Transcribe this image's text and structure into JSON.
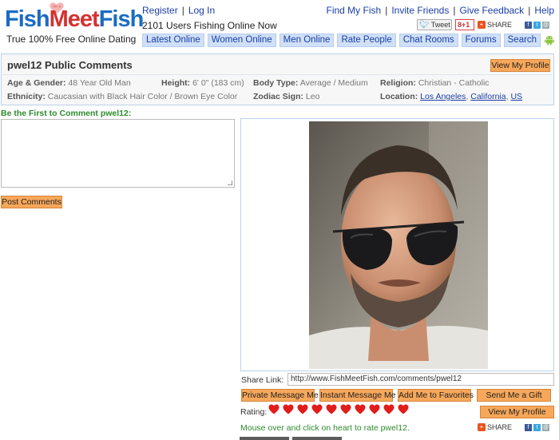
{
  "logo": {
    "part1": "Fish",
    "part2": "Meet",
    "part3": "Fish",
    "tagline": "True 100% Free Online Dating"
  },
  "top_links": {
    "register": "Register",
    "login": "Log In"
  },
  "online_count": "2101 Users Fishing Online Now",
  "right_links": [
    "Find My Fish",
    "Invite Friends",
    "Give Feedback",
    "Help"
  ],
  "social": {
    "tweet": "Tweet",
    "gplus": "8+1",
    "share": "SHARE"
  },
  "nav_tabs": [
    "Latest Online",
    "Women Online",
    "Men Online",
    "Rate People",
    "Chat Rooms",
    "Forums",
    "Search"
  ],
  "profile": {
    "title": "pwel12 Public Comments",
    "view_profile": "View My Profile",
    "age_gender_label": "Age & Gender:",
    "age_gender": "48 Year Old Man",
    "height_label": "Height:",
    "height": "6' 0\" (183 cm)",
    "body_type_label": "Body Type:",
    "body_type": "Average / Medium",
    "religion_label": "Religion:",
    "religion": "Christian - Catholic",
    "ethnicity_label": "Ethnicity:",
    "ethnicity": "Caucasian with Black Hair Color / Brown Eye Color",
    "zodiac_label": "Zodiac Sign:",
    "zodiac": "Leo",
    "location_label": "Location:",
    "location_city": "Los Angeles",
    "location_sep": ", ",
    "location_state": "California",
    "location_sep2": ", ",
    "location_country": "US"
  },
  "comments": {
    "heading": "Be the First to Comment pwel12:",
    "post_button": "Post Comments"
  },
  "share_link": {
    "label": "Share Link:",
    "value": "http://www.FishMeetFish.com/comments/pwel12"
  },
  "actions": [
    "Private Message Me",
    "Instant Message Me",
    "Add Me to Favorites",
    "Send Me a Gift"
  ],
  "rating": {
    "label": "Rating:",
    "hearts": 10,
    "view_profile": "View My Profile",
    "hint": "Mouse over and click on heart to rate pwel12."
  },
  "colors": {
    "brand_blue": "#1a6cc2",
    "brand_red": "#d63131",
    "orange_button": "#f6a75a",
    "heart": "#e21b1b",
    "green_text": "#2e8b2e"
  }
}
